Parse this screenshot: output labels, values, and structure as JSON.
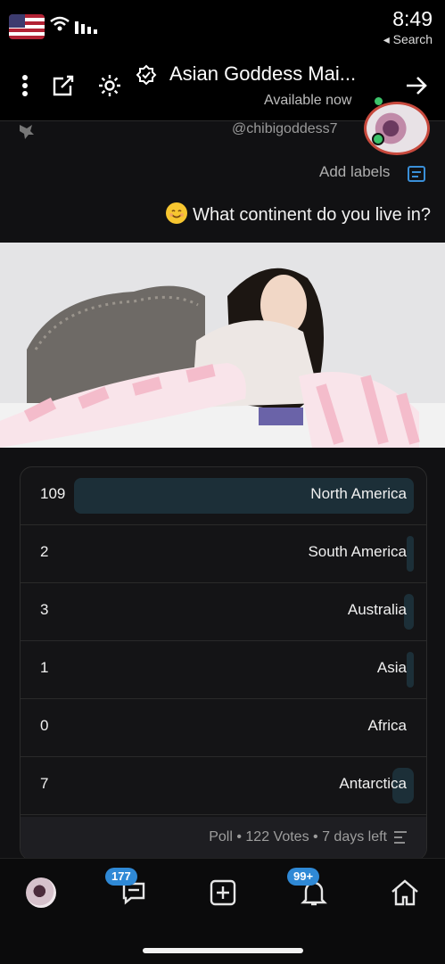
{
  "status_bar": {
    "time": "8:49",
    "back_label": "◂ Search"
  },
  "header": {
    "title": "Asian Goddess Mai...",
    "availability": "Available now",
    "colors": {
      "online": "#3cc36a",
      "accent": "#2f89d6"
    }
  },
  "post": {
    "handle": "@chibigoddess7",
    "labels_text": "Add labels",
    "question": "What continent do you live in?"
  },
  "poll": {
    "options": [
      {
        "label": "North America",
        "count": "109",
        "share": 0.893
      },
      {
        "label": "South America",
        "count": "2",
        "share": 0.016
      },
      {
        "label": "Australia",
        "count": "3",
        "share": 0.025
      },
      {
        "label": "Asia",
        "count": "1",
        "share": 0.008
      },
      {
        "label": "Africa",
        "count": "0",
        "share": 0.0
      },
      {
        "label": "Antarctica",
        "count": "7",
        "share": 0.057
      }
    ],
    "footer": "Poll • 122 Votes • 7 days left"
  },
  "nav": {
    "notifications_badge": "99+",
    "messages_badge": "177",
    "icons": [
      "home-icon",
      "notifications-icon",
      "create-icon",
      "messages-icon",
      "profile-avatar"
    ]
  }
}
